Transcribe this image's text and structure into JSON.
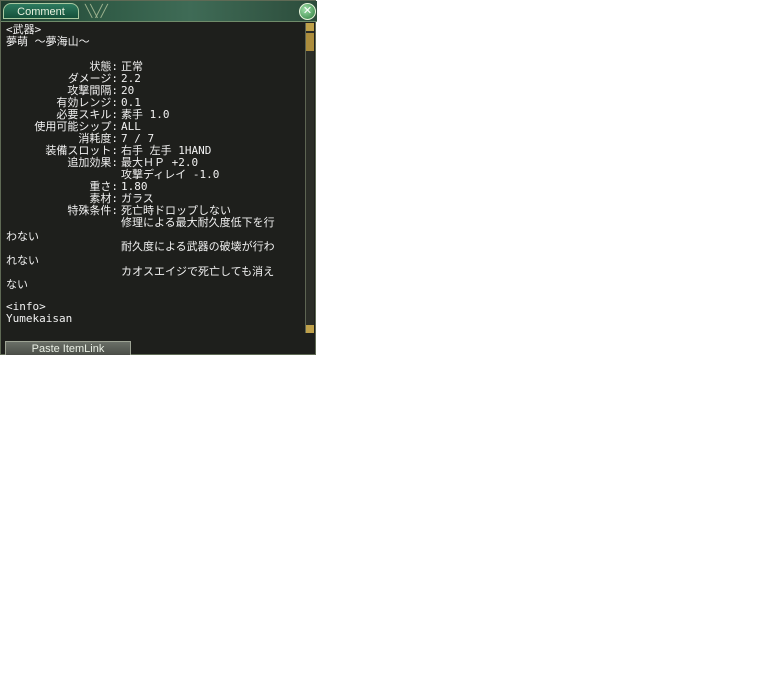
{
  "window": {
    "tab_title": "Comment",
    "close_glyph": "✕",
    "footer_button": "Paste ItemLink"
  },
  "item": {
    "category": "<武器>",
    "name": "夢萌 ～夢海山～",
    "stats": [
      {
        "label": "状態:",
        "value": "正常"
      },
      {
        "label": "ダメージ:",
        "value": "2.2"
      },
      {
        "label": "攻撃間隔:",
        "value": "20"
      },
      {
        "label": "有効レンジ:",
        "value": "0.1"
      },
      {
        "label": "必要スキル:",
        "value": "素手 1.0"
      },
      {
        "label": "使用可能シップ:",
        "value": "ALL"
      },
      {
        "label": "消耗度:",
        "value": "7 / 7"
      },
      {
        "label": "装備スロット:",
        "value": "右手 左手 1HAND"
      },
      {
        "label": "追加効果:",
        "value": "最大ＨＰ +2.0"
      },
      {
        "label": "",
        "value": "攻撃ディレイ -1.0"
      },
      {
        "label": "重さ:",
        "value": "1.80"
      },
      {
        "label": "素材:",
        "value": "ガラス"
      },
      {
        "label": "特殊条件:",
        "value": "死亡時ドロップしない"
      },
      {
        "label": "",
        "value": "修理による最大耐久度低下を行"
      }
    ],
    "wrap_lines": [
      "わない",
      "耐久度による武器の破壊が行わ",
      "れない",
      "カオスエイジで死亡しても消え",
      "ない"
    ],
    "info_header": "<info>",
    "info_text": "Yumekaisan"
  }
}
